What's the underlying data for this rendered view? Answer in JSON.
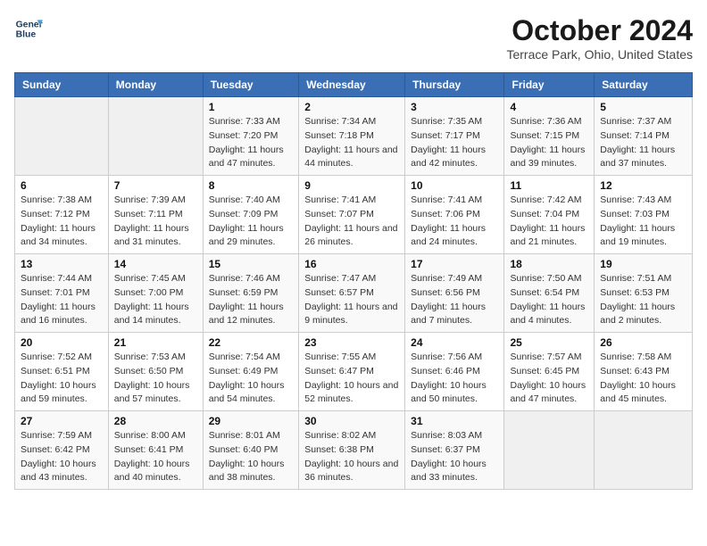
{
  "logo": {
    "line1": "General",
    "line2": "Blue"
  },
  "title": "October 2024",
  "location": "Terrace Park, Ohio, United States",
  "weekdays": [
    "Sunday",
    "Monday",
    "Tuesday",
    "Wednesday",
    "Thursday",
    "Friday",
    "Saturday"
  ],
  "weeks": [
    [
      {
        "day": "",
        "sunrise": "",
        "sunset": "",
        "daylight": ""
      },
      {
        "day": "",
        "sunrise": "",
        "sunset": "",
        "daylight": ""
      },
      {
        "day": "1",
        "sunrise": "Sunrise: 7:33 AM",
        "sunset": "Sunset: 7:20 PM",
        "daylight": "Daylight: 11 hours and 47 minutes."
      },
      {
        "day": "2",
        "sunrise": "Sunrise: 7:34 AM",
        "sunset": "Sunset: 7:18 PM",
        "daylight": "Daylight: 11 hours and 44 minutes."
      },
      {
        "day": "3",
        "sunrise": "Sunrise: 7:35 AM",
        "sunset": "Sunset: 7:17 PM",
        "daylight": "Daylight: 11 hours and 42 minutes."
      },
      {
        "day": "4",
        "sunrise": "Sunrise: 7:36 AM",
        "sunset": "Sunset: 7:15 PM",
        "daylight": "Daylight: 11 hours and 39 minutes."
      },
      {
        "day": "5",
        "sunrise": "Sunrise: 7:37 AM",
        "sunset": "Sunset: 7:14 PM",
        "daylight": "Daylight: 11 hours and 37 minutes."
      }
    ],
    [
      {
        "day": "6",
        "sunrise": "Sunrise: 7:38 AM",
        "sunset": "Sunset: 7:12 PM",
        "daylight": "Daylight: 11 hours and 34 minutes."
      },
      {
        "day": "7",
        "sunrise": "Sunrise: 7:39 AM",
        "sunset": "Sunset: 7:11 PM",
        "daylight": "Daylight: 11 hours and 31 minutes."
      },
      {
        "day": "8",
        "sunrise": "Sunrise: 7:40 AM",
        "sunset": "Sunset: 7:09 PM",
        "daylight": "Daylight: 11 hours and 29 minutes."
      },
      {
        "day": "9",
        "sunrise": "Sunrise: 7:41 AM",
        "sunset": "Sunset: 7:07 PM",
        "daylight": "Daylight: 11 hours and 26 minutes."
      },
      {
        "day": "10",
        "sunrise": "Sunrise: 7:41 AM",
        "sunset": "Sunset: 7:06 PM",
        "daylight": "Daylight: 11 hours and 24 minutes."
      },
      {
        "day": "11",
        "sunrise": "Sunrise: 7:42 AM",
        "sunset": "Sunset: 7:04 PM",
        "daylight": "Daylight: 11 hours and 21 minutes."
      },
      {
        "day": "12",
        "sunrise": "Sunrise: 7:43 AM",
        "sunset": "Sunset: 7:03 PM",
        "daylight": "Daylight: 11 hours and 19 minutes."
      }
    ],
    [
      {
        "day": "13",
        "sunrise": "Sunrise: 7:44 AM",
        "sunset": "Sunset: 7:01 PM",
        "daylight": "Daylight: 11 hours and 16 minutes."
      },
      {
        "day": "14",
        "sunrise": "Sunrise: 7:45 AM",
        "sunset": "Sunset: 7:00 PM",
        "daylight": "Daylight: 11 hours and 14 minutes."
      },
      {
        "day": "15",
        "sunrise": "Sunrise: 7:46 AM",
        "sunset": "Sunset: 6:59 PM",
        "daylight": "Daylight: 11 hours and 12 minutes."
      },
      {
        "day": "16",
        "sunrise": "Sunrise: 7:47 AM",
        "sunset": "Sunset: 6:57 PM",
        "daylight": "Daylight: 11 hours and 9 minutes."
      },
      {
        "day": "17",
        "sunrise": "Sunrise: 7:49 AM",
        "sunset": "Sunset: 6:56 PM",
        "daylight": "Daylight: 11 hours and 7 minutes."
      },
      {
        "day": "18",
        "sunrise": "Sunrise: 7:50 AM",
        "sunset": "Sunset: 6:54 PM",
        "daylight": "Daylight: 11 hours and 4 minutes."
      },
      {
        "day": "19",
        "sunrise": "Sunrise: 7:51 AM",
        "sunset": "Sunset: 6:53 PM",
        "daylight": "Daylight: 11 hours and 2 minutes."
      }
    ],
    [
      {
        "day": "20",
        "sunrise": "Sunrise: 7:52 AM",
        "sunset": "Sunset: 6:51 PM",
        "daylight": "Daylight: 10 hours and 59 minutes."
      },
      {
        "day": "21",
        "sunrise": "Sunrise: 7:53 AM",
        "sunset": "Sunset: 6:50 PM",
        "daylight": "Daylight: 10 hours and 57 minutes."
      },
      {
        "day": "22",
        "sunrise": "Sunrise: 7:54 AM",
        "sunset": "Sunset: 6:49 PM",
        "daylight": "Daylight: 10 hours and 54 minutes."
      },
      {
        "day": "23",
        "sunrise": "Sunrise: 7:55 AM",
        "sunset": "Sunset: 6:47 PM",
        "daylight": "Daylight: 10 hours and 52 minutes."
      },
      {
        "day": "24",
        "sunrise": "Sunrise: 7:56 AM",
        "sunset": "Sunset: 6:46 PM",
        "daylight": "Daylight: 10 hours and 50 minutes."
      },
      {
        "day": "25",
        "sunrise": "Sunrise: 7:57 AM",
        "sunset": "Sunset: 6:45 PM",
        "daylight": "Daylight: 10 hours and 47 minutes."
      },
      {
        "day": "26",
        "sunrise": "Sunrise: 7:58 AM",
        "sunset": "Sunset: 6:43 PM",
        "daylight": "Daylight: 10 hours and 45 minutes."
      }
    ],
    [
      {
        "day": "27",
        "sunrise": "Sunrise: 7:59 AM",
        "sunset": "Sunset: 6:42 PM",
        "daylight": "Daylight: 10 hours and 43 minutes."
      },
      {
        "day": "28",
        "sunrise": "Sunrise: 8:00 AM",
        "sunset": "Sunset: 6:41 PM",
        "daylight": "Daylight: 10 hours and 40 minutes."
      },
      {
        "day": "29",
        "sunrise": "Sunrise: 8:01 AM",
        "sunset": "Sunset: 6:40 PM",
        "daylight": "Daylight: 10 hours and 38 minutes."
      },
      {
        "day": "30",
        "sunrise": "Sunrise: 8:02 AM",
        "sunset": "Sunset: 6:38 PM",
        "daylight": "Daylight: 10 hours and 36 minutes."
      },
      {
        "day": "31",
        "sunrise": "Sunrise: 8:03 AM",
        "sunset": "Sunset: 6:37 PM",
        "daylight": "Daylight: 10 hours and 33 minutes."
      },
      {
        "day": "",
        "sunrise": "",
        "sunset": "",
        "daylight": ""
      },
      {
        "day": "",
        "sunrise": "",
        "sunset": "",
        "daylight": ""
      }
    ]
  ]
}
